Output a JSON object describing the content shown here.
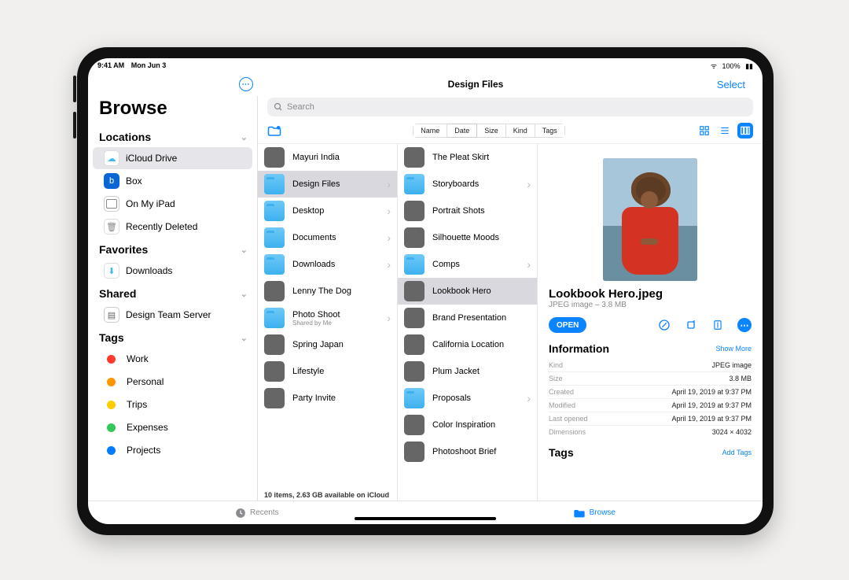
{
  "status": {
    "time": "9:41 AM",
    "date": "Mon Jun 3",
    "battery": "100%"
  },
  "header": {
    "title": "Design Files",
    "select": "Select"
  },
  "search": {
    "placeholder": "Search"
  },
  "sidebar": {
    "title": "Browse",
    "sections": {
      "locations": "Locations",
      "favorites": "Favorites",
      "shared": "Shared",
      "tags": "Tags"
    },
    "locations": [
      {
        "label": "iCloud Drive",
        "selected": true
      },
      {
        "label": "Box"
      },
      {
        "label": "On My iPad"
      },
      {
        "label": "Recently Deleted"
      }
    ],
    "favorites": [
      {
        "label": "Downloads"
      }
    ],
    "shared": [
      {
        "label": "Design Team Server"
      }
    ],
    "tags": [
      {
        "label": "Work",
        "color": "#ff3b30"
      },
      {
        "label": "Personal",
        "color": "#ff9500"
      },
      {
        "label": "Trips",
        "color": "#ffcc00"
      },
      {
        "label": "Expenses",
        "color": "#34c759"
      },
      {
        "label": "Projects",
        "color": "#007aff"
      }
    ]
  },
  "sort": {
    "name": "Name",
    "date": "Date",
    "size": "Size",
    "kind": "Kind",
    "tags": "Tags",
    "active": "Date"
  },
  "col1": {
    "items": [
      {
        "label": "Mayuri India",
        "type": "img",
        "cls": "th-green"
      },
      {
        "label": "Design Files",
        "type": "folder",
        "selected": true,
        "arrow": true
      },
      {
        "label": "Desktop",
        "type": "folder",
        "arrow": true
      },
      {
        "label": "Documents",
        "type": "folder",
        "arrow": true
      },
      {
        "label": "Downloads",
        "type": "folder",
        "arrow": true
      },
      {
        "label": "Lenny The Dog",
        "type": "img",
        "cls": "th-bw"
      },
      {
        "label": "Photo Shoot",
        "sub": "Shared by Me",
        "type": "folder",
        "arrow": true
      },
      {
        "label": "Spring Japan",
        "type": "img",
        "cls": "th-orange"
      },
      {
        "label": "Lifestyle",
        "type": "img",
        "cls": "th-bw"
      },
      {
        "label": "Party Invite",
        "type": "img",
        "cls": "th-red"
      }
    ],
    "footer": "10 items, 2.63 GB available on iCloud"
  },
  "col2": {
    "items": [
      {
        "label": "The Pleat Skirt",
        "type": "img",
        "cls": "th-blue"
      },
      {
        "label": "Storyboards",
        "type": "folder",
        "arrow": true
      },
      {
        "label": "Portrait Shots",
        "type": "img",
        "cls": "th-sand"
      },
      {
        "label": "Silhouette Moods",
        "type": "img",
        "cls": "th-red"
      },
      {
        "label": "Comps",
        "type": "folder",
        "arrow": true
      },
      {
        "label": "Lookbook Hero",
        "type": "img",
        "cls": "th-red",
        "selected": true
      },
      {
        "label": "Brand Presentation",
        "type": "img",
        "cls": "th-white"
      },
      {
        "label": "California Location",
        "type": "img",
        "cls": "th-sand"
      },
      {
        "label": "Plum Jacket",
        "type": "img",
        "cls": "th-purple"
      },
      {
        "label": "Proposals",
        "type": "folder",
        "arrow": true
      },
      {
        "label": "Color Inspiration",
        "type": "img",
        "cls": "th-yellow"
      },
      {
        "label": "Photoshoot Brief",
        "type": "img",
        "cls": "th-bw"
      }
    ]
  },
  "detail": {
    "filename": "Lookbook Hero.jpeg",
    "meta": "JPEG image – 3.8 MB",
    "open": "OPEN",
    "info_label": "Information",
    "show_more": "Show More",
    "rows": [
      {
        "k": "Kind",
        "v": "JPEG image"
      },
      {
        "k": "Size",
        "v": "3.8 MB"
      },
      {
        "k": "Created",
        "v": "April 19, 2019 at 9:37 PM"
      },
      {
        "k": "Modified",
        "v": "April 19, 2019 at 9:37 PM"
      },
      {
        "k": "Last opened",
        "v": "April 19, 2019 at 9:37 PM"
      },
      {
        "k": "Dimensions",
        "v": "3024 × 4032"
      }
    ],
    "tags_label": "Tags",
    "add_tags": "Add Tags"
  },
  "bottom": {
    "recents": "Recents",
    "browse": "Browse"
  }
}
